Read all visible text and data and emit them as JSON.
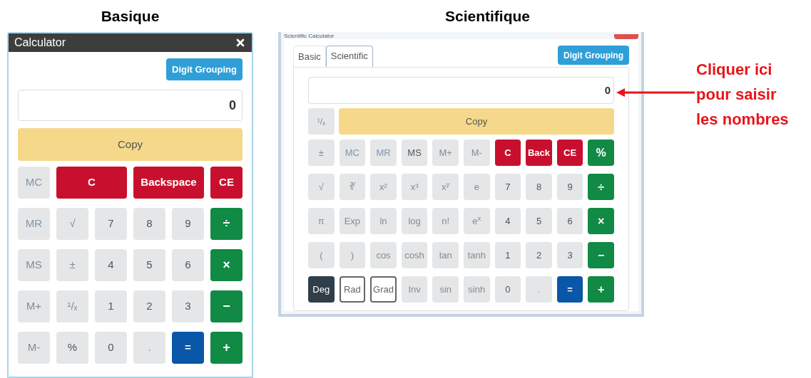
{
  "basic": {
    "heading": "Basique",
    "window": {
      "title": "Calculator"
    },
    "digit_grouping": "Digit Grouping",
    "display": "0",
    "copy": "Copy",
    "keys": [
      {
        "label": "MC",
        "kind": "inactive"
      },
      {
        "label": "C",
        "kind": "wide"
      },
      {
        "label": "Backspace",
        "kind": "wide"
      },
      {
        "label": "CE",
        "kind": "danger"
      },
      {
        "label": "MR",
        "kind": "inactive"
      },
      {
        "label": "√",
        "kind": "function"
      },
      {
        "label": "7",
        "kind": "digit"
      },
      {
        "label": "8",
        "kind": "digit"
      },
      {
        "label": "9",
        "kind": "digit"
      },
      {
        "label": "÷",
        "kind": "success"
      },
      {
        "label": "MS",
        "kind": "function"
      },
      {
        "label": "±",
        "kind": "function"
      },
      {
        "label": "4",
        "kind": "digit"
      },
      {
        "label": "5",
        "kind": "digit"
      },
      {
        "label": "6",
        "kind": "digit"
      },
      {
        "label": "×",
        "kind": "success"
      },
      {
        "label": "M+",
        "kind": "function"
      },
      {
        "label": "¹/ₓ",
        "kind": "function"
      },
      {
        "label": "1",
        "kind": "digit"
      },
      {
        "label": "2",
        "kind": "digit"
      },
      {
        "label": "3",
        "kind": "digit"
      },
      {
        "label": "−",
        "kind": "success"
      },
      {
        "label": "M-",
        "kind": "function"
      },
      {
        "label": "%",
        "kind": "digit"
      },
      {
        "label": "0",
        "kind": "digit"
      },
      {
        "label": ".",
        "kind": "function"
      },
      {
        "label": "=",
        "kind": "primary"
      },
      {
        "label": "+",
        "kind": "success"
      }
    ]
  },
  "scientific": {
    "heading": "Scientifique",
    "window": {
      "title": "Scientific Calculator"
    },
    "tabs": [
      {
        "label": "Basic",
        "selected": false
      },
      {
        "label": "Scientific",
        "selected": true
      }
    ],
    "digit_grouping": "Digit Grouping",
    "display": "0",
    "reciprocal": "¹/ₓ",
    "copy": "Copy",
    "keys": [
      {
        "label": "±",
        "kind": "function"
      },
      {
        "label": "MC",
        "kind": "inactive"
      },
      {
        "label": "MR",
        "kind": "inactive"
      },
      {
        "label": "MS",
        "kind": "digit"
      },
      {
        "label": "M+",
        "kind": "function"
      },
      {
        "label": "M-",
        "kind": "function"
      },
      {
        "label": "C",
        "kind": "danger"
      },
      {
        "label": "Back",
        "kind": "danger"
      },
      {
        "label": "CE",
        "kind": "danger"
      },
      {
        "label": "%",
        "kind": "success"
      },
      {
        "label": "√",
        "kind": "function"
      },
      {
        "label": "∛",
        "kind": "function"
      },
      {
        "label": "x²",
        "kind": "function"
      },
      {
        "label": "x³",
        "kind": "function"
      },
      {
        "label": "x$^{y}$",
        "kind": "function"
      },
      {
        "label": "e",
        "kind": "function"
      },
      {
        "label": "7",
        "kind": "digit"
      },
      {
        "label": "8",
        "kind": "digit"
      },
      {
        "label": "9",
        "kind": "digit"
      },
      {
        "label": "÷",
        "kind": "success"
      },
      {
        "label": "π",
        "kind": "function"
      },
      {
        "label": "Exp",
        "kind": "function"
      },
      {
        "label": "ln",
        "kind": "function"
      },
      {
        "label": "log",
        "kind": "function"
      },
      {
        "label": "n!",
        "kind": "function"
      },
      {
        "label": "e$^{x}$",
        "kind": "function"
      },
      {
        "label": "4",
        "kind": "digit"
      },
      {
        "label": "5",
        "kind": "digit"
      },
      {
        "label": "6",
        "kind": "digit"
      },
      {
        "label": "×",
        "kind": "success"
      },
      {
        "label": "(",
        "kind": "function"
      },
      {
        "label": ")",
        "kind": "function"
      },
      {
        "label": "cos",
        "kind": "function"
      },
      {
        "label": "cosh",
        "kind": "function"
      },
      {
        "label": "tan",
        "kind": "function"
      },
      {
        "label": "tanh",
        "kind": "function"
      },
      {
        "label": "1",
        "kind": "digit"
      },
      {
        "label": "2",
        "kind": "digit"
      },
      {
        "label": "3",
        "kind": "digit"
      },
      {
        "label": "−",
        "kind": "success"
      },
      {
        "label": "Deg",
        "kind": "mode",
        "selected": true
      },
      {
        "label": "Rad",
        "kind": "mode",
        "selected": false
      },
      {
        "label": "Grad",
        "kind": "mode",
        "selected": false
      },
      {
        "label": "Inv",
        "kind": "function"
      },
      {
        "label": "sin",
        "kind": "function"
      },
      {
        "label": "sinh",
        "kind": "function"
      },
      {
        "label": "0",
        "kind": "digit"
      },
      {
        "label": ".",
        "kind": "function"
      },
      {
        "label": "=",
        "kind": "primary"
      },
      {
        "label": "+",
        "kind": "success"
      }
    ]
  },
  "annotation": {
    "lines": [
      "Cliquer ici",
      "pour saisir",
      "les nombres"
    ]
  }
}
